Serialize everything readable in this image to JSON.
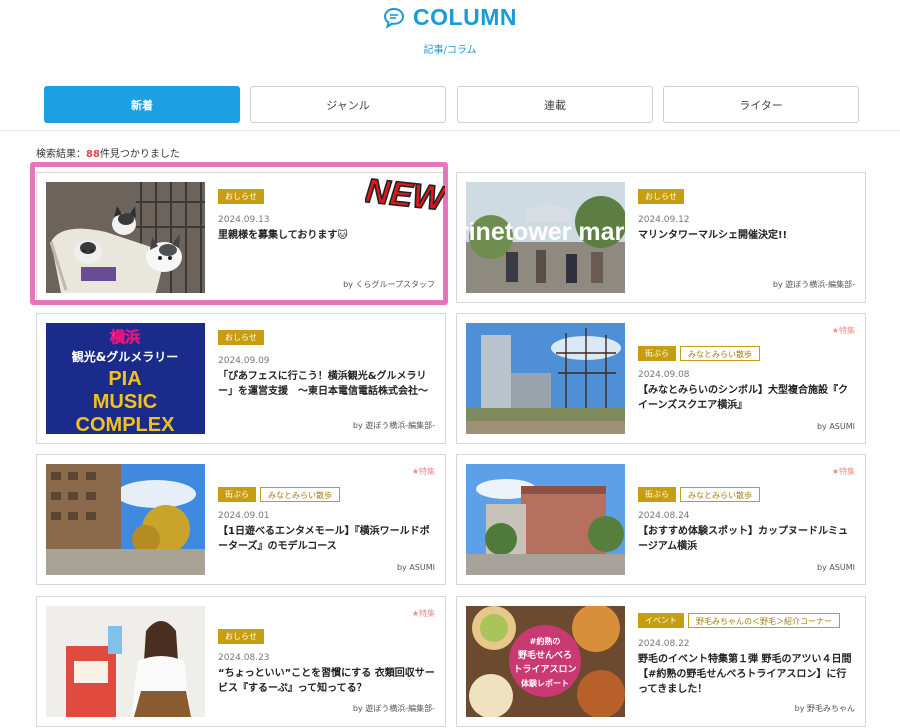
{
  "header": {
    "title": "COLUMN",
    "subtitle": "記事/コラム",
    "icon": "chat-bubble-icon"
  },
  "tabs": [
    {
      "label": "新着",
      "active": true
    },
    {
      "label": "ジャンル",
      "active": false
    },
    {
      "label": "連載",
      "active": false
    },
    {
      "label": "ライター",
      "active": false
    }
  ],
  "search_result": {
    "prefix": "検索結果：",
    "count": "88",
    "suffix": "件見つかりました"
  },
  "overlay": {
    "new_label": "NEW",
    "accent_color": "#e060b0"
  },
  "colors": {
    "primary": "#1c9fe3",
    "tag_gold": "#c79d12",
    "count_red": "#e04848"
  },
  "articles": [
    {
      "tags": [
        "おしらせ"
      ],
      "outline_tag": "",
      "feature": "",
      "date": "2024.09.13",
      "title": "里親様を募集しております",
      "title_emoji": "🐱",
      "author": "by くらグループスタッフ",
      "image": "kittens-photo"
    },
    {
      "tags": [
        "おしらせ"
      ],
      "outline_tag": "",
      "feature": "",
      "date": "2024.09.12",
      "title": "マリンタワーマルシェ開催決定!!",
      "author": "by 遊ぼう横浜-編集部-",
      "image": "marinetower-marche-photo",
      "image_text": "marinetower marche"
    },
    {
      "tags": [
        "おしらせ"
      ],
      "outline_tag": "",
      "feature": "",
      "date": "2024.09.09",
      "title": "「ぴあフェスに行こう！横浜観光&グルメラリー」を運営支援　〜東日本電信電話株式会社〜",
      "author": "by 遊ぼう横浜-編集部-",
      "image": "pia-music-complex-banner",
      "image_text": [
        "横浜",
        "観光&グルメラリー",
        "PIA",
        "MUSIC",
        "COMPLEX"
      ]
    },
    {
      "tags": [
        "街ぶら"
      ],
      "outline_tag": "みなとみらい散歩",
      "feature": "★特集",
      "date": "2024.09.08",
      "title": "【みなとみらいのシンボル】大型複合施設『クイーンズスクエア横浜』",
      "author": "by ASUMI",
      "image": "queens-square-photo"
    },
    {
      "tags": [
        "街ぶら"
      ],
      "outline_tag": "みなとみらい散歩",
      "feature": "★特集",
      "date": "2024.09.01",
      "title": "【1日遊べるエンタメモール】『横浜ワールドポーターズ』のモデルコース",
      "author": "by ASUMI",
      "image": "world-porters-photo"
    },
    {
      "tags": [
        "街ぶら"
      ],
      "outline_tag": "みなとみらい散歩",
      "feature": "★特集",
      "date": "2024.08.24",
      "title": "【おすすめ体験スポット】カップヌードルミュージアム横浜",
      "author": "by ASUMI",
      "image": "cupnoodle-museum-photo"
    },
    {
      "tags": [
        "おしらせ"
      ],
      "outline_tag": "",
      "feature": "★特集",
      "date": "2024.08.23",
      "title": "“ちょっといい”ことを習慣にする 衣類回収サービス『するーぷ』って知ってる？",
      "author": "by 遊ぼう横浜-編集部-",
      "image": "clothing-recycle-photo"
    },
    {
      "tags": [
        "イベント"
      ],
      "outline_tag": "野毛みちゃんの＜野毛＞紹介コーナー",
      "feature": "",
      "date": "2024.08.22",
      "title": "野毛のイベント特集第１弾 野毛のアツい４日間【#約熟の野毛せんべろトライアスロン】に行ってきました！",
      "author": "by 野毛みちゃん",
      "image": "noge-food-photo",
      "image_text": [
        "#約熟の",
        "野毛せんべろ",
        "トライアスロン",
        "体験レポート"
      ]
    }
  ]
}
